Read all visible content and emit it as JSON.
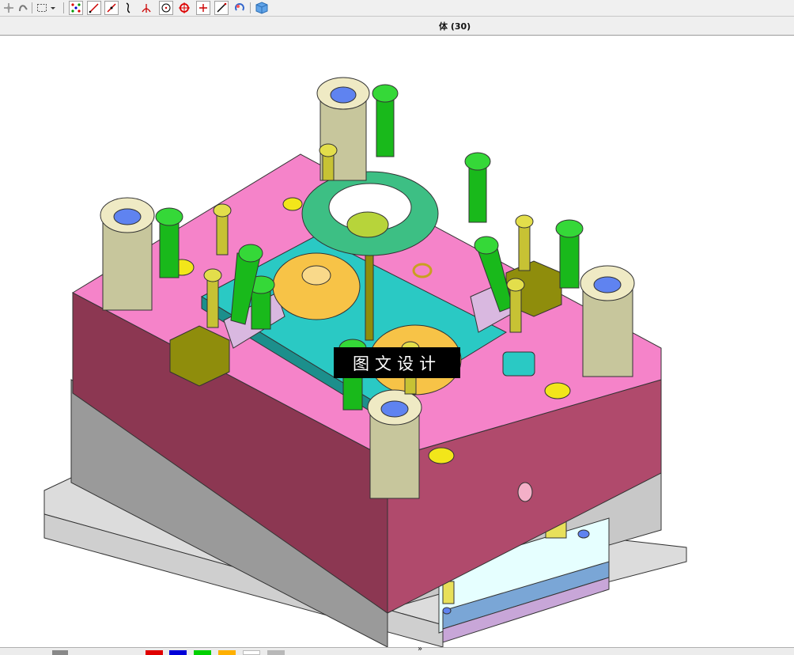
{
  "toolbar": {
    "icons": [
      "move-icon",
      "pan-icon",
      "select-box-icon",
      "dropdown-arrow-icon",
      "point-grid-icon",
      "line-icon",
      "line-arrow-icon",
      "curve-icon",
      "axis-icon",
      "circle-center-icon",
      "circle-target-icon",
      "cross-point-icon",
      "diagonal-line-icon",
      "view-rotate-icon",
      "cube-icon"
    ]
  },
  "status": {
    "label": "体 (30)"
  },
  "watermark": {
    "text": "图文设计"
  },
  "taskbar": {
    "swatches": [
      "#e00000",
      "#0000d8",
      "#00d000",
      "#ffb000",
      "#ffffff",
      "#b8b8b8"
    ],
    "chevron": "»"
  },
  "colors": {
    "plate_pink": "#f583c9",
    "plate_pink_side": "#b24d78",
    "cavity_teal": "#2ac9c4",
    "pillar_khaki": "#c7c69c",
    "bolt_green": "#19b91b",
    "disc_orange": "#f7c347",
    "ring_green": "#3dbf84",
    "base_gray": "#d4d4d4",
    "hole_yellow": "#f2e61a",
    "hole_blue": "#5f83f0",
    "slider_olive": "#8f8d0c"
  }
}
